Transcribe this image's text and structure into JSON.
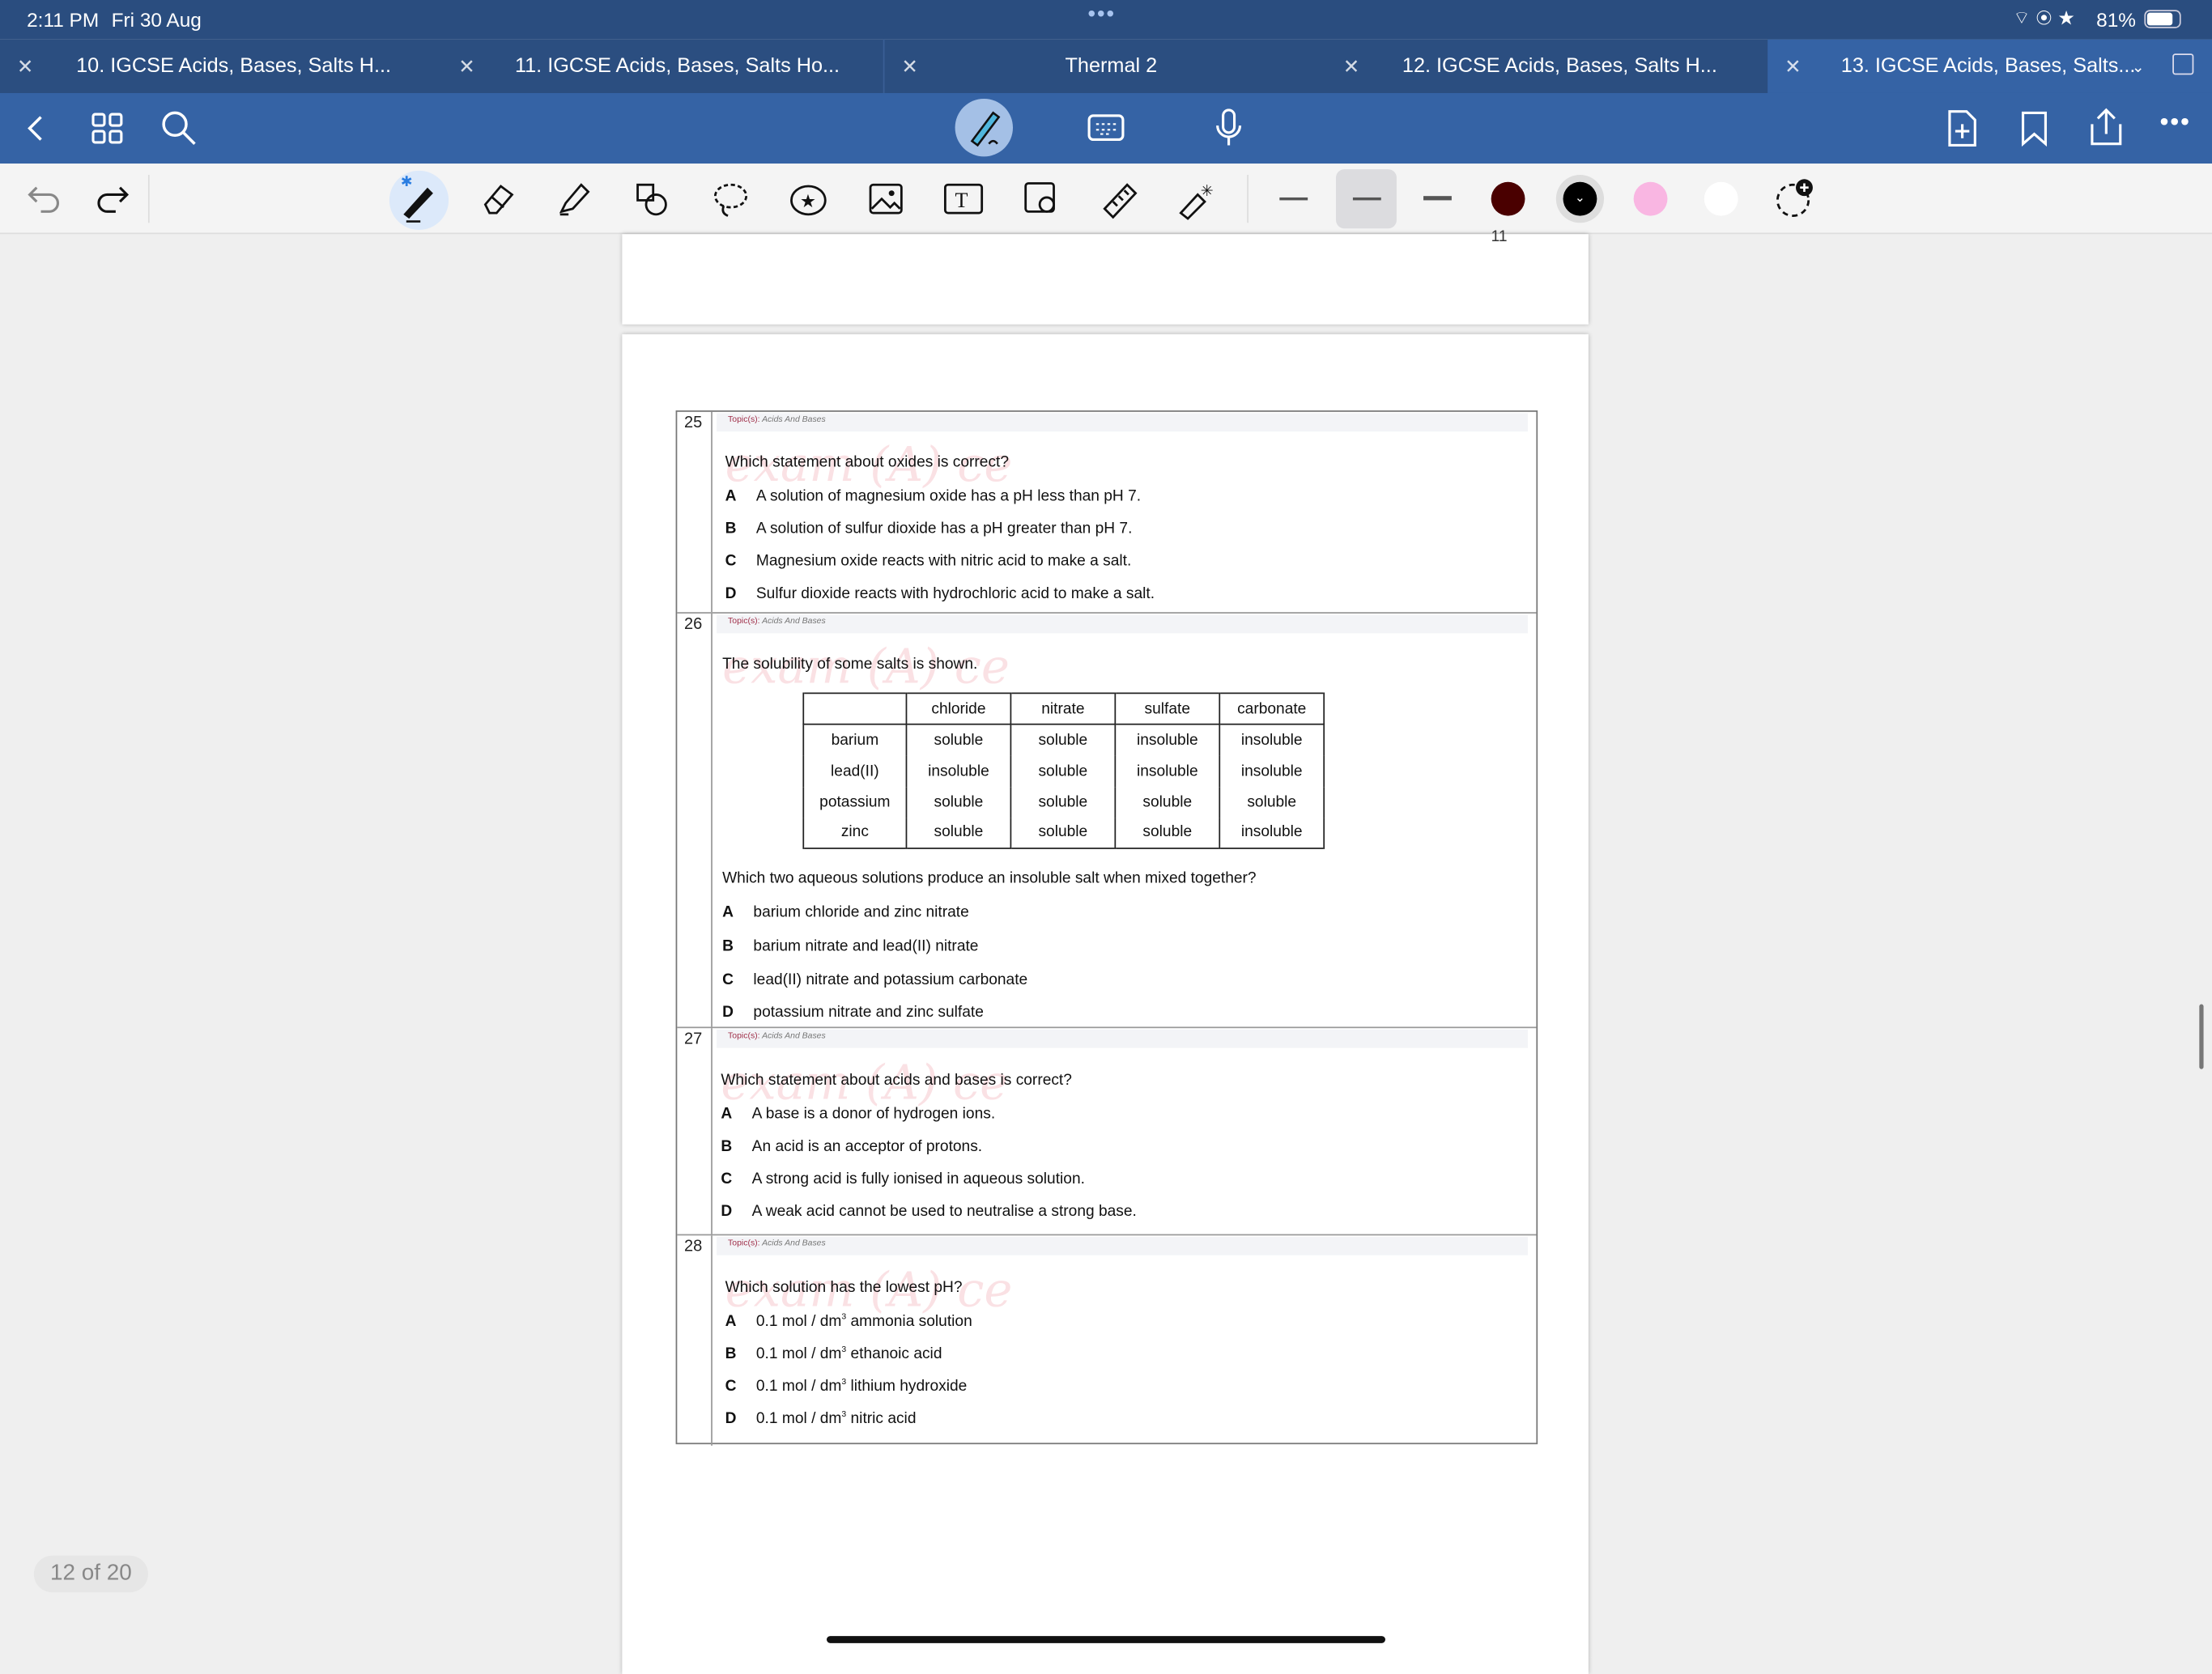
{
  "status": {
    "time": "2:11 PM",
    "date": "Fri 30 Aug",
    "battery": "81%"
  },
  "tabs": [
    {
      "label": "10. IGCSE Acids, Bases, Salts H..."
    },
    {
      "label": "11. IGCSE Acids, Bases, Salts Ho..."
    },
    {
      "label": "Thermal 2"
    },
    {
      "label": "12. IGCSE Acids, Bases, Salts H..."
    },
    {
      "label": "13. IGCSE Acids, Bases, Salts...",
      "active": true
    }
  ],
  "colors": {
    "accent": "#3563a5",
    "ink_dark_red": "#4a0000",
    "ink_black": "#000000",
    "ink_pink": "#f9b6e2",
    "ink_white": "#ffffff"
  },
  "page_indicator": "12 of 20",
  "prev_page_number": "11",
  "topic_prefix": "Topic(s):",
  "topic": "Acids And Bases",
  "questions": [
    {
      "num": "25",
      "stem": "Which statement about oxides is correct?",
      "options": [
        {
          "l": "A",
          "t": "A solution of magnesium oxide has a pH less than pH 7."
        },
        {
          "l": "B",
          "t": "A solution of sulfur dioxide has a pH greater than pH 7."
        },
        {
          "l": "C",
          "t": "Magnesium oxide reacts with nitric acid to make a salt."
        },
        {
          "l": "D",
          "t": "Sulfur dioxide reacts with hydrochloric acid to make a salt."
        }
      ]
    },
    {
      "num": "26",
      "stem": "The solubility of some salts is shown.",
      "stem2": "Which two aqueous solutions produce an insoluble salt when mixed together?",
      "table": {
        "headers": [
          "",
          "chloride",
          "nitrate",
          "sulfate",
          "carbonate"
        ],
        "rows": [
          [
            "barium",
            "soluble",
            "soluble",
            "insoluble",
            "insoluble"
          ],
          [
            "lead(II)",
            "insoluble",
            "soluble",
            "insoluble",
            "insoluble"
          ],
          [
            "potassium",
            "soluble",
            "soluble",
            "soluble",
            "soluble"
          ],
          [
            "zinc",
            "soluble",
            "soluble",
            "soluble",
            "insoluble"
          ]
        ]
      },
      "options": [
        {
          "l": "A",
          "t": "barium chloride and zinc nitrate"
        },
        {
          "l": "B",
          "t": "barium nitrate and lead(II) nitrate"
        },
        {
          "l": "C",
          "t": "lead(II) nitrate and potassium carbonate"
        },
        {
          "l": "D",
          "t": "potassium nitrate and zinc sulfate"
        }
      ]
    },
    {
      "num": "27",
      "stem": "Which statement about acids and bases is correct?",
      "options": [
        {
          "l": "A",
          "t": "A base is a donor of hydrogen ions."
        },
        {
          "l": "B",
          "t": "An acid is an acceptor of protons."
        },
        {
          "l": "C",
          "t": "A strong acid is fully ionised in aqueous solution."
        },
        {
          "l": "D",
          "t": "A weak acid cannot be used to neutralise a strong base."
        }
      ]
    },
    {
      "num": "28",
      "stem": "Which solution has the lowest pH?",
      "unit": "0.1 mol / dm",
      "exp": "3",
      "options": [
        {
          "l": "A",
          "t": "ammonia solution"
        },
        {
          "l": "B",
          "t": "ethanoic acid"
        },
        {
          "l": "C",
          "t": "lithium hydroxide"
        },
        {
          "l": "D",
          "t": "nitric acid"
        }
      ]
    }
  ]
}
